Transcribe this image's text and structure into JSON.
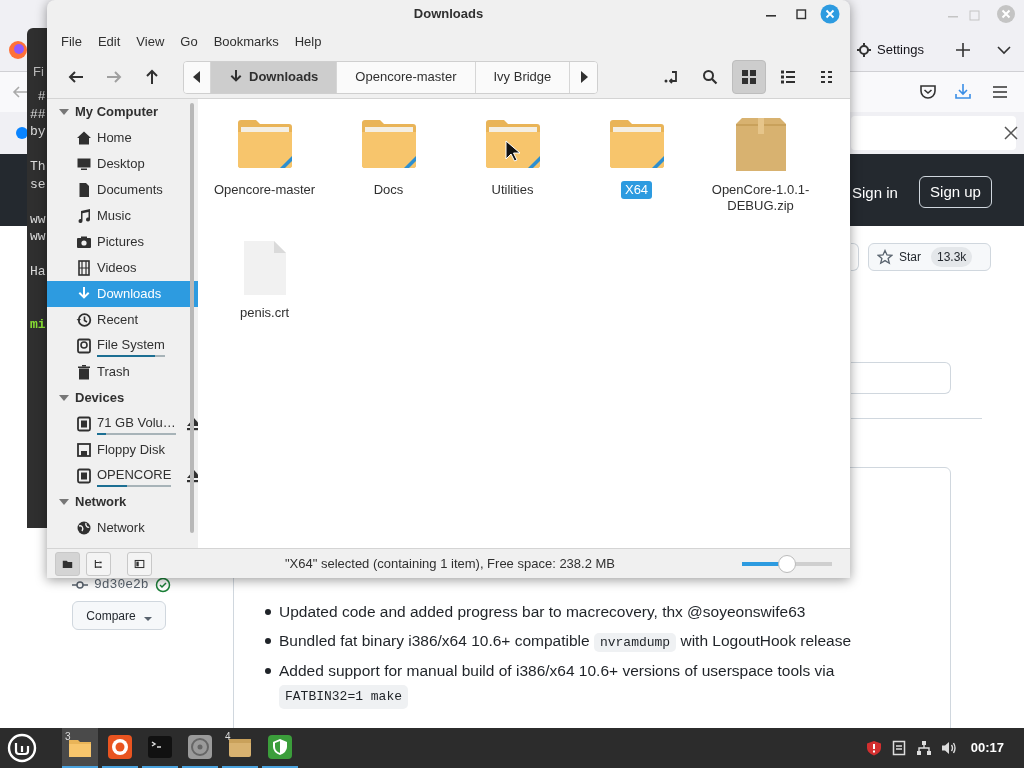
{
  "browser": {
    "tab": {
      "label": "Settings"
    },
    "header": {
      "sign_in": "Sign in",
      "sign_up": "Sign up"
    },
    "star": {
      "label": "Star",
      "count": "13.3k"
    },
    "commit": {
      "hash": "9d30e2b",
      "verified": true
    },
    "compare": "Compare",
    "notes": [
      {
        "parts": [
          {
            "kind": "text",
            "text": "Updated code and added progress bar to macrecovery, thx @soyeonswife63"
          }
        ]
      },
      {
        "parts": [
          {
            "kind": "text",
            "text": "Bundled fat binary i386/x64 10.6+ compatible "
          },
          {
            "kind": "code",
            "text": "nvramdump"
          },
          {
            "kind": "text",
            "text": " with LogoutHook release"
          }
        ]
      },
      {
        "parts": [
          {
            "kind": "text",
            "text": "Added support for manual build of i386/x64 10.6+ versions of userspace tools via"
          },
          {
            "kind": "code_block",
            "text": "FATBIN32=1 make"
          }
        ]
      }
    ]
  },
  "terminal": {
    "title": "Fi",
    "lines": [
      {
        "kind": "text",
        "text": " #"
      },
      {
        "kind": "text",
        "text": "##"
      },
      {
        "kind": "text",
        "text": "by"
      },
      {
        "kind": "blank"
      },
      {
        "kind": "text",
        "text": "Th"
      },
      {
        "kind": "text",
        "text": "se"
      },
      {
        "kind": "blank"
      },
      {
        "kind": "text",
        "text": "ww"
      },
      {
        "kind": "text",
        "text": "ww"
      },
      {
        "kind": "blank"
      },
      {
        "kind": "text",
        "text": "Ha"
      },
      {
        "kind": "blank"
      },
      {
        "kind": "blank"
      },
      {
        "kind": "prompt",
        "text": "mi"
      }
    ]
  },
  "file_manager": {
    "title": "Downloads",
    "menu": [
      "File",
      "Edit",
      "View",
      "Go",
      "Bookmarks",
      "Help"
    ],
    "nav": [
      {
        "kind": "back",
        "disabled": false
      },
      {
        "kind": "forward",
        "disabled": true
      },
      {
        "kind": "up",
        "disabled": false
      }
    ],
    "path": [
      {
        "label": "Downloads",
        "kind": "downloads",
        "selected": true
      },
      {
        "label": "Opencore-master",
        "kind": "folder",
        "selected": false
      },
      {
        "label": "Ivy Bridge",
        "kind": "folder",
        "selected": false
      }
    ],
    "view_buttons": [
      {
        "kind": "location",
        "selected": false
      },
      {
        "kind": "search",
        "selected": false
      },
      {
        "kind": "icons",
        "selected": true
      },
      {
        "kind": "list",
        "selected": false
      },
      {
        "kind": "compact",
        "selected": false
      }
    ],
    "sidebar": [
      {
        "title": "My Computer",
        "expanded": true,
        "items": [
          {
            "label": "Home",
            "kind": "home",
            "selected": false
          },
          {
            "label": "Desktop",
            "kind": "desktop",
            "selected": false
          },
          {
            "label": "Documents",
            "kind": "documents",
            "selected": false
          },
          {
            "label": "Music",
            "kind": "music",
            "selected": false
          },
          {
            "label": "Pictures",
            "kind": "pictures",
            "selected": false
          },
          {
            "label": "Videos",
            "kind": "videos",
            "selected": false
          },
          {
            "label": "Downloads",
            "kind": "downloads",
            "selected": true
          },
          {
            "label": "Recent",
            "kind": "recent",
            "selected": false
          },
          {
            "label": "File System",
            "kind": "drive",
            "selected": false,
            "level": 0.85
          },
          {
            "label": "Trash",
            "kind": "trash",
            "selected": false
          }
        ]
      },
      {
        "title": "Devices",
        "expanded": true,
        "items": [
          {
            "label": "71 GB Volu…",
            "kind": "chip",
            "selected": false,
            "level": 0.12,
            "ejectable": true
          },
          {
            "label": "Floppy Disk",
            "kind": "floppy",
            "selected": false
          },
          {
            "label": "OPENCORE",
            "kind": "chip",
            "selected": false,
            "level": 0.4,
            "ejectable": true
          }
        ]
      },
      {
        "title": "Network",
        "expanded": true,
        "items": [
          {
            "label": "Network",
            "kind": "network",
            "selected": false
          }
        ]
      }
    ],
    "items": [
      {
        "name": "Opencore-master",
        "kind": "folder",
        "selected": false
      },
      {
        "name": "Docs",
        "kind": "folder",
        "selected": false
      },
      {
        "name": "Utilities",
        "kind": "folder",
        "selected": false
      },
      {
        "name": "X64",
        "kind": "folder",
        "selected": true
      },
      {
        "name": "OpenCore-1.0.1-DEBUG.zip",
        "kind": "archive",
        "selected": false
      },
      {
        "name": "penis.crt",
        "kind": "file",
        "selected": false
      }
    ],
    "status_buttons": [
      {
        "kind": "places",
        "selected": true
      },
      {
        "kind": "tree",
        "selected": false
      },
      {
        "kind": "sidebar",
        "selected": false
      }
    ],
    "status": "\"X64\" selected (containing 1 item), Free space: 238.2 MB",
    "zoom": {
      "level": 0.5
    }
  },
  "taskbar": {
    "apps": [
      {
        "kind": "files",
        "badge": "3",
        "active": true
      },
      {
        "kind": "firefox",
        "active": false
      },
      {
        "kind": "terminal",
        "active": false
      },
      {
        "kind": "disks",
        "active": false
      },
      {
        "kind": "archive",
        "badge": "4",
        "active": false
      },
      {
        "kind": "shield",
        "active": false
      }
    ],
    "clock": "00:17"
  }
}
